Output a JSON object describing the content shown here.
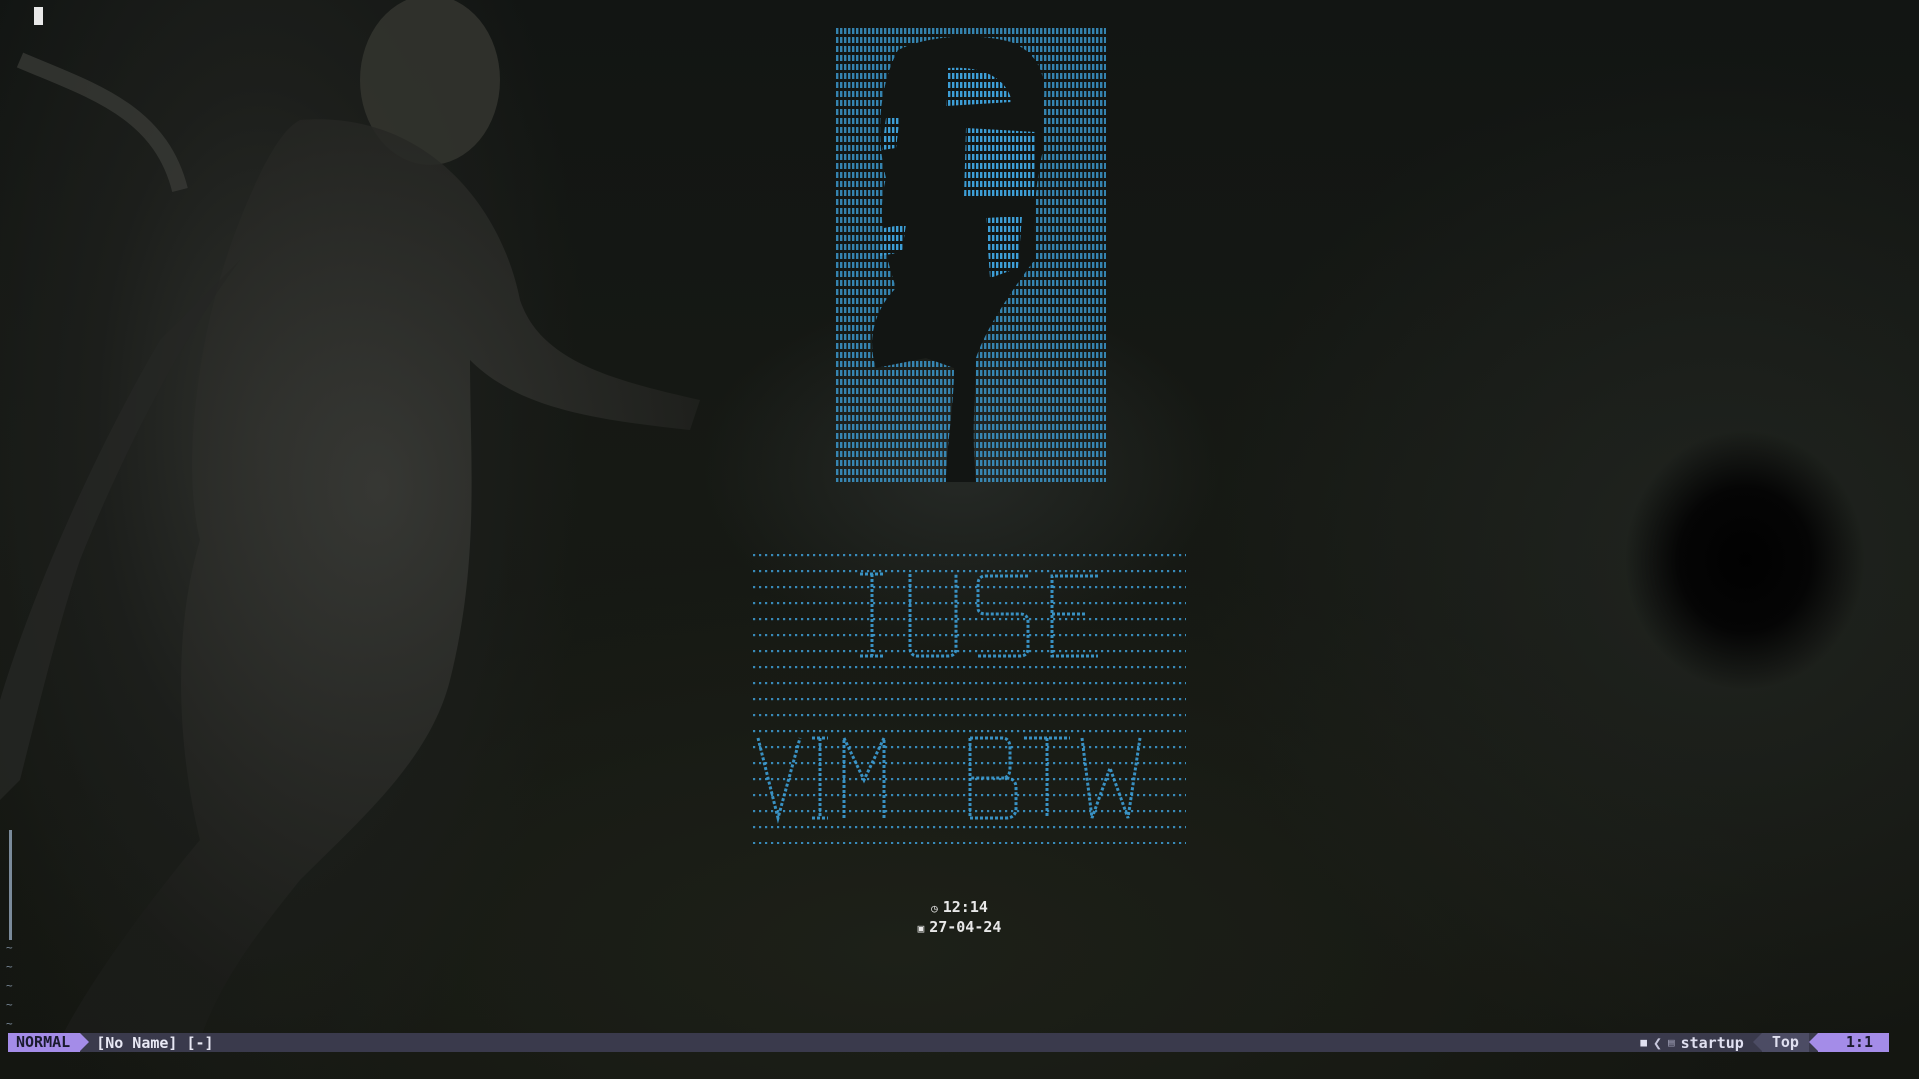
{
  "editor": {
    "clock": {
      "time": "12:14",
      "date": "27-04-24",
      "time_icon": "clock-icon",
      "date_icon": "calendar-icon"
    },
    "statusline": {
      "mode": "NORMAL",
      "filename": "[No Name] [-]",
      "filetype": "startup",
      "progress": "Top",
      "location": "1:1"
    },
    "empty_line_marker": "~"
  },
  "colors": {
    "ascii_art": "#3d9ed6",
    "mode_bg": "#a48ce8",
    "statusline_bg": "#3a3a4c",
    "text": "#e8e8e8"
  }
}
